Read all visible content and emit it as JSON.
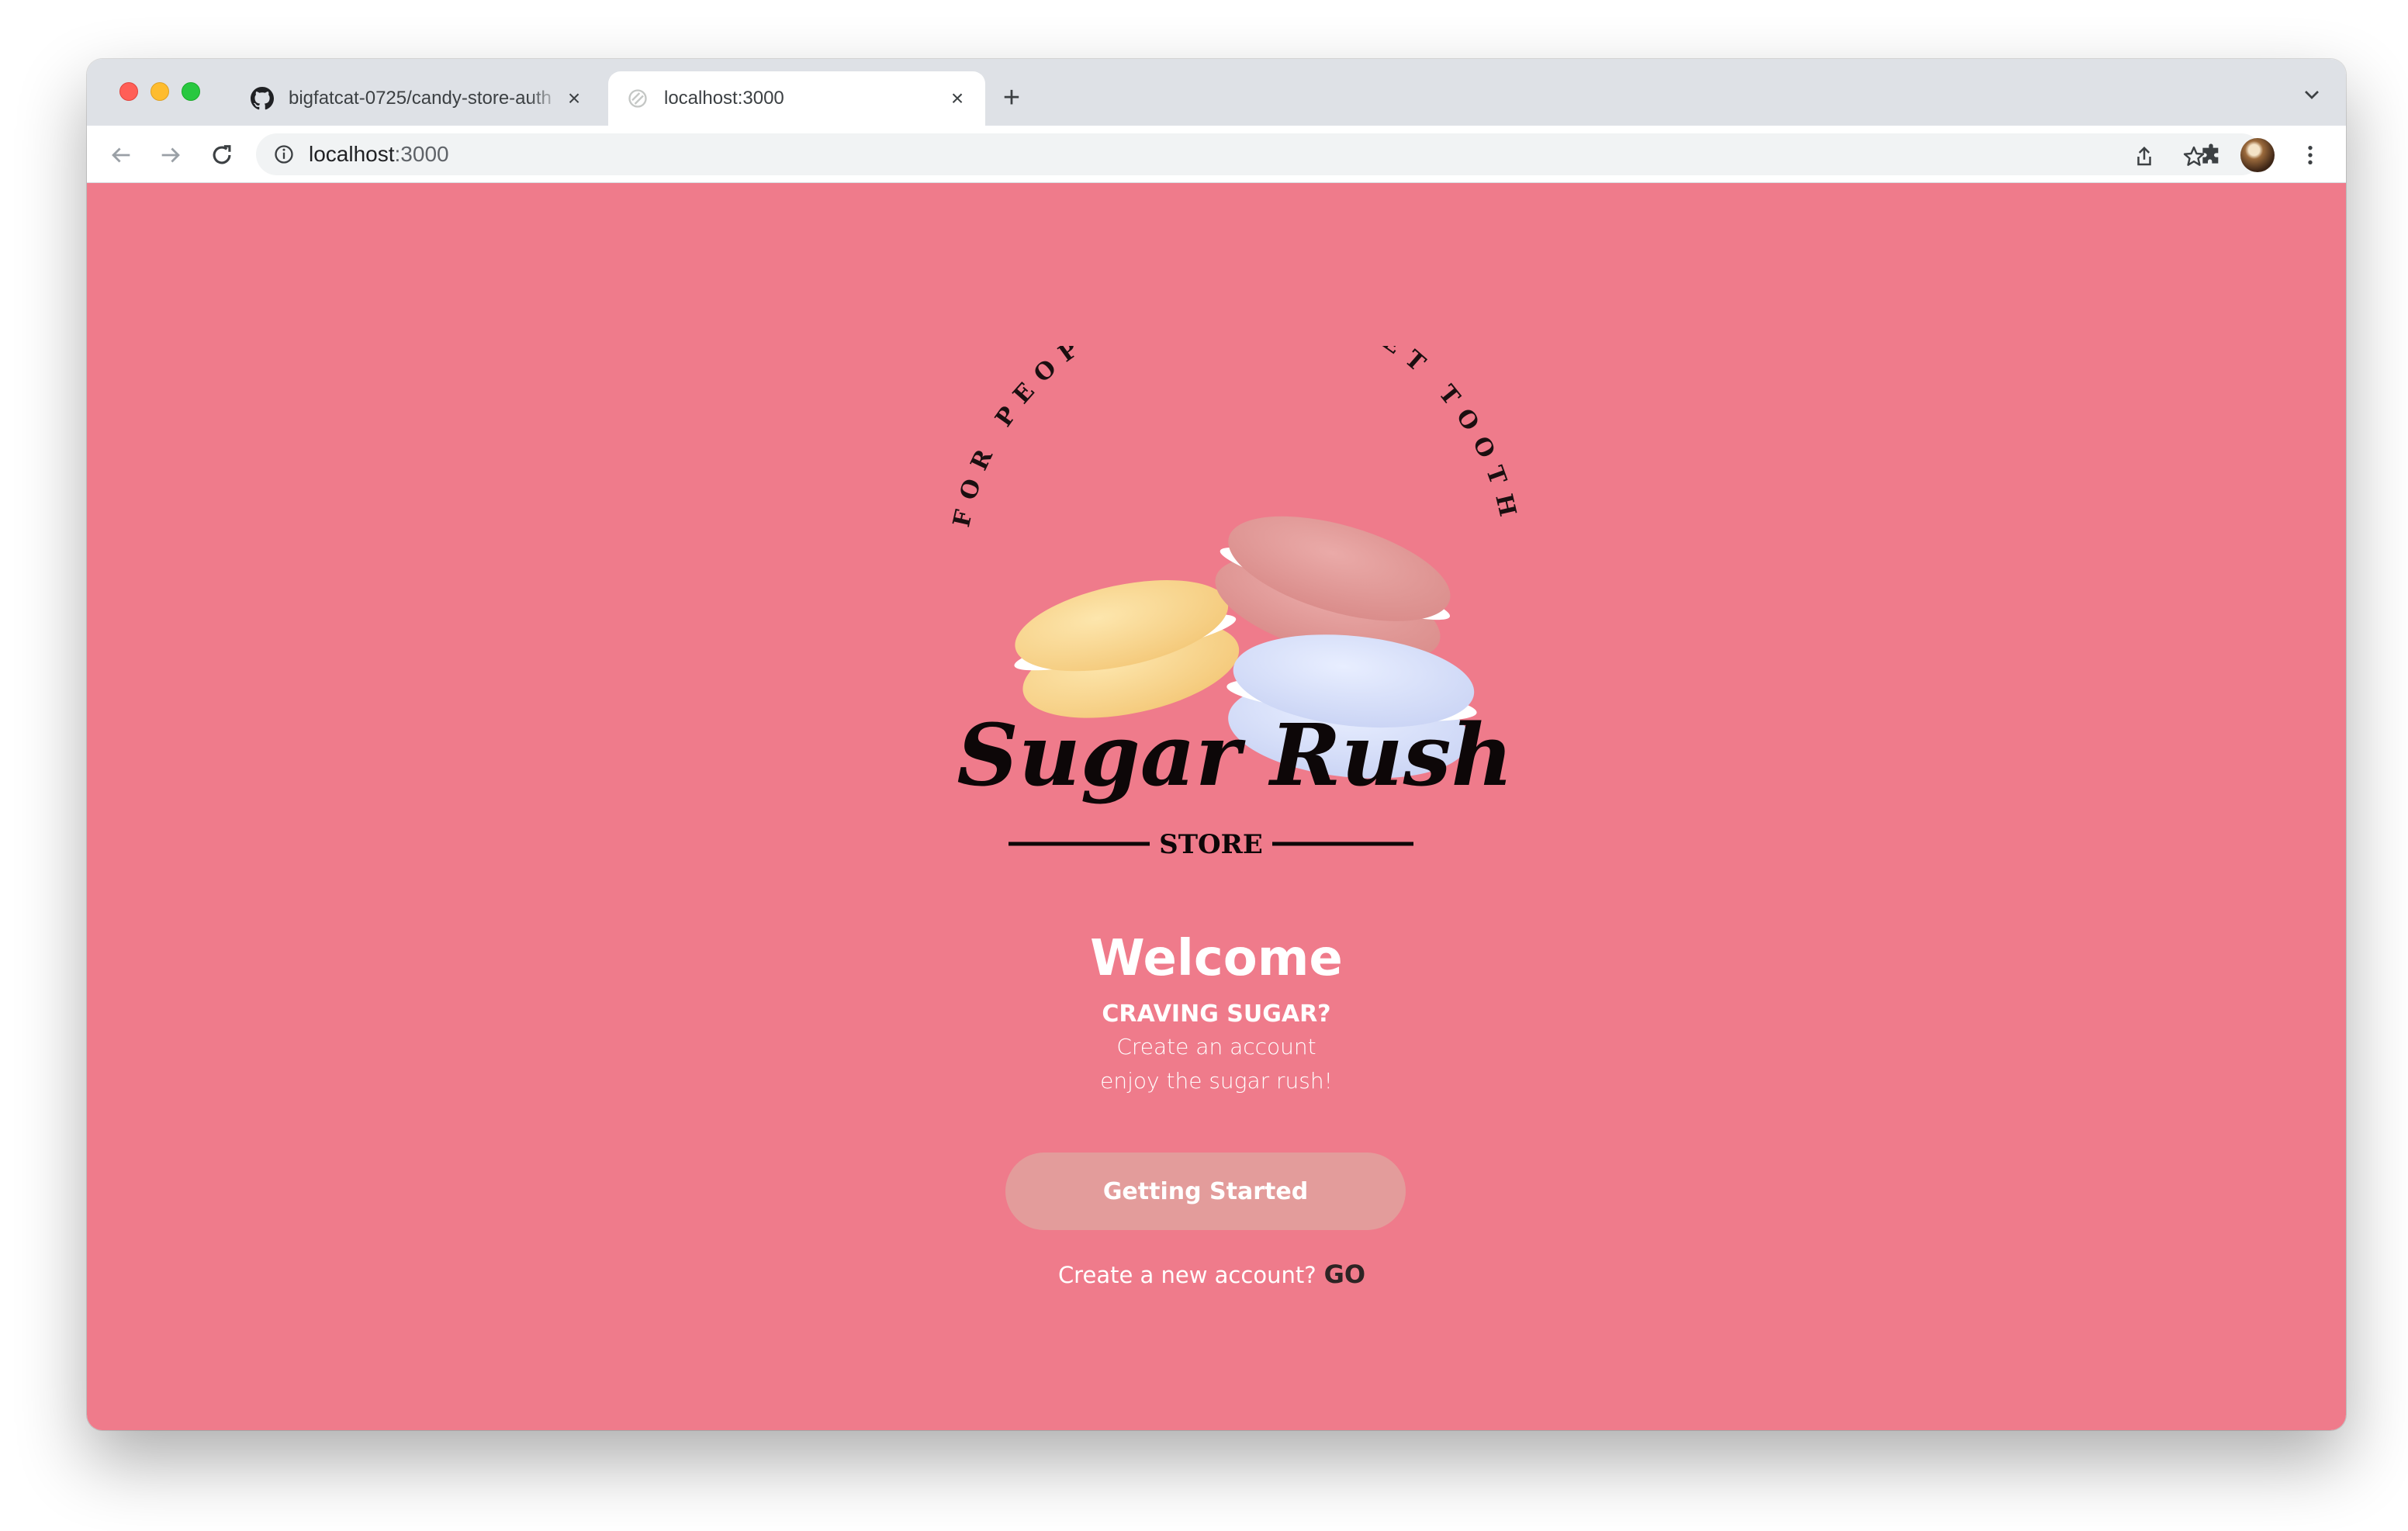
{
  "browser": {
    "tabs": [
      {
        "title": "bigfatcat-0725/candy-store-auth",
        "favicon": "github-icon",
        "active": false
      },
      {
        "title": "localhost:3000",
        "favicon": "globe-icon",
        "active": true
      }
    ],
    "address": {
      "host": "localhost",
      "port": ":3000"
    }
  },
  "page": {
    "logo": {
      "arc_text": "FOR PEOPLE WITH SWEET TOOTH",
      "brand": "Sugar Rush",
      "tagline": "STORE"
    },
    "heading": "Welcome",
    "subheading": "CRAVING SUGAR?",
    "line1": "Create an account",
    "line2": "enjoy the sugar rush!",
    "cta_label": "Getting Started",
    "signup_prompt": "Create a new account?",
    "signup_link": "GO"
  },
  "colors": {
    "page_bg": "#ef7b8b",
    "cta_bg": "#e39c9b",
    "macaron_yellow": "#fbdc9a",
    "macaron_pink": "#e39c9b",
    "macaron_blue": "#dde5fb"
  }
}
